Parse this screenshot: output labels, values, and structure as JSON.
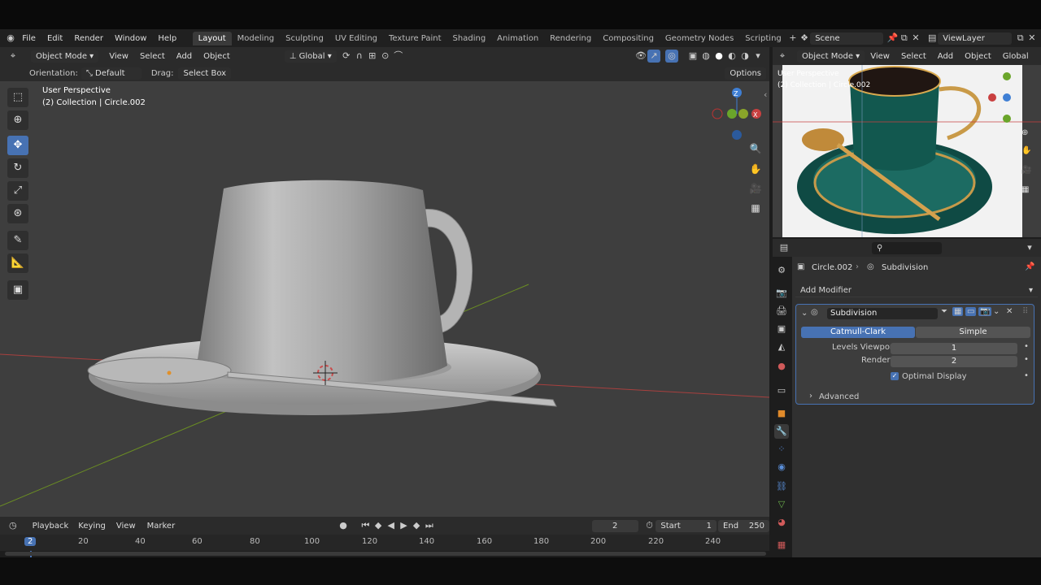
{
  "menu": {
    "file": "File",
    "edit": "Edit",
    "render": "Render",
    "window": "Window",
    "help": "Help"
  },
  "workspaces": [
    "Layout",
    "Modeling",
    "Sculpting",
    "UV Editing",
    "Texture Paint",
    "Shading",
    "Animation",
    "Rendering",
    "Compositing",
    "Geometry Nodes",
    "Scripting"
  ],
  "scene": {
    "label": "Scene",
    "view_layer": "ViewLayer"
  },
  "viewport_header": {
    "mode": "Object Mode",
    "view": "View",
    "select": "Select",
    "add": "Add",
    "object": "Object",
    "transform_orientation": "Global"
  },
  "tool_settings": {
    "orientation_label": "Orientation:",
    "orientation_value": "Default",
    "drag_label": "Drag:",
    "drag_value": "Select Box",
    "options": "Options"
  },
  "viewport_info": {
    "perspective": "User Perspective",
    "collection": "(2) Collection | Circle.002"
  },
  "ref_viewport": {
    "mode": "Object Mode",
    "view": "View",
    "select": "Select",
    "add": "Add",
    "object": "Object",
    "orientation": "Global",
    "perspective": "User Perspective",
    "collection": "(2) Collection | Circle.002"
  },
  "properties": {
    "object_name": "Circle.002",
    "modifier_crumb": "Subdivision",
    "add_modifier": "Add Modifier",
    "modifier_name": "Subdivision",
    "algo_catmull": "Catmull-Clark",
    "algo_simple": "Simple",
    "levels_viewport_label": "Levels Viewport",
    "levels_viewport_value": "1",
    "render_label": "Render",
    "render_value": "2",
    "optimal_display": "Optimal Display",
    "advanced": "Advanced"
  },
  "timeline": {
    "playback": "Playback",
    "keying": "Keying",
    "view": "View",
    "marker": "Marker",
    "current_frame": "2",
    "start_label": "Start",
    "start_value": "1",
    "end_label": "End",
    "end_value": "250",
    "ticks": [
      "2",
      "20",
      "40",
      "60",
      "80",
      "100",
      "120",
      "140",
      "160",
      "180",
      "200",
      "220",
      "240"
    ]
  },
  "colors": {
    "accent": "#4772b3",
    "viewport_bg": "#3e3e3e",
    "x_axis": "#a8403f",
    "y_axis": "#6b8e23"
  }
}
